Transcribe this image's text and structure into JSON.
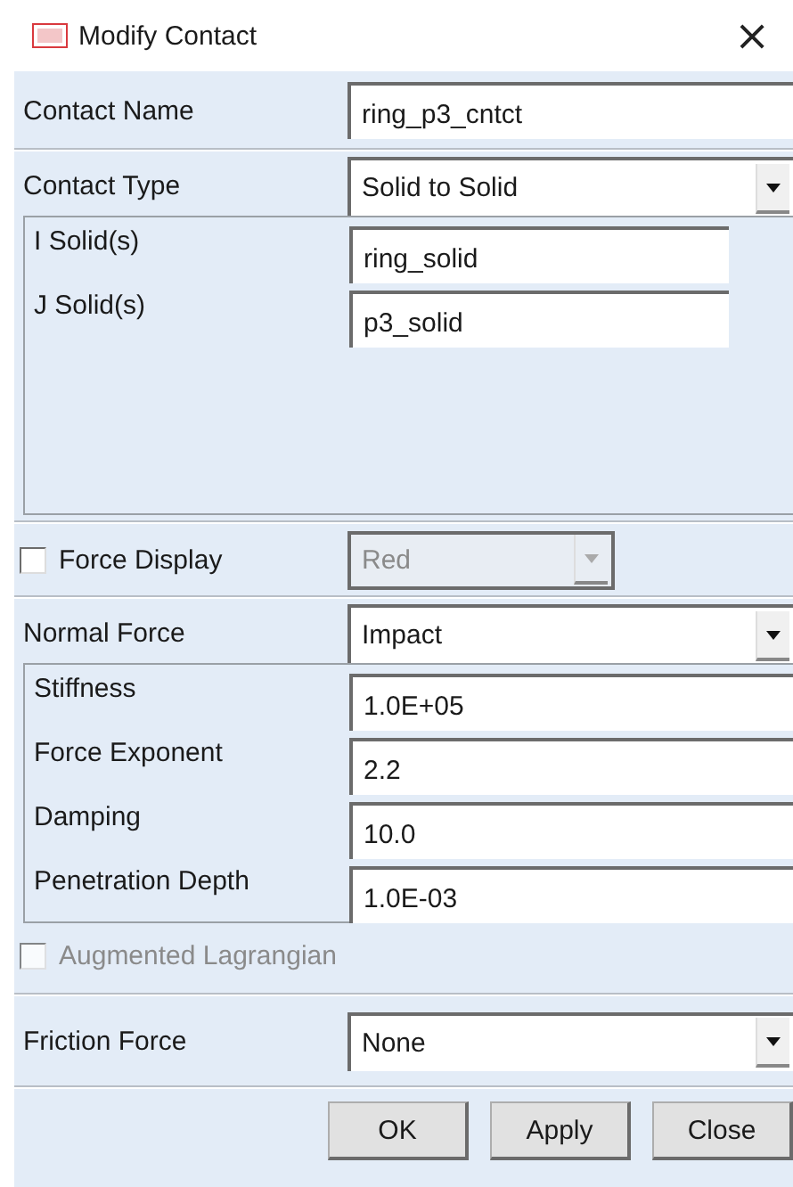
{
  "window": {
    "title": "Modify Contact",
    "close": "×"
  },
  "contact_name": {
    "label": "Contact Name",
    "value": "ring_p3_cntct"
  },
  "contact_type": {
    "label": "Contact Type",
    "value": "Solid to Solid"
  },
  "solids": [
    {
      "label": "I Solid(s)",
      "value": "ring_solid"
    },
    {
      "label": "J Solid(s)",
      "value": "p3_solid"
    }
  ],
  "force_display": {
    "label": "Force Display",
    "checked": false,
    "color_value": "Red",
    "color_disabled": true
  },
  "normal_force": {
    "label": "Normal Force",
    "value": "Impact"
  },
  "impact_parameters": [
    {
      "label": "Stiffness",
      "value": "1.0E+05"
    },
    {
      "label": "Force Exponent",
      "value": "2.2"
    },
    {
      "label": "Damping",
      "value": "10.0"
    },
    {
      "label": "Penetration Depth",
      "value": "1.0E-03"
    }
  ],
  "augmented_lagrangian": {
    "label": "Augmented Lagrangian",
    "checked": false,
    "disabled": true
  },
  "friction_force": {
    "label": "Friction Force",
    "value": "None"
  },
  "buttons": [
    "OK",
    "Apply",
    "Close"
  ]
}
